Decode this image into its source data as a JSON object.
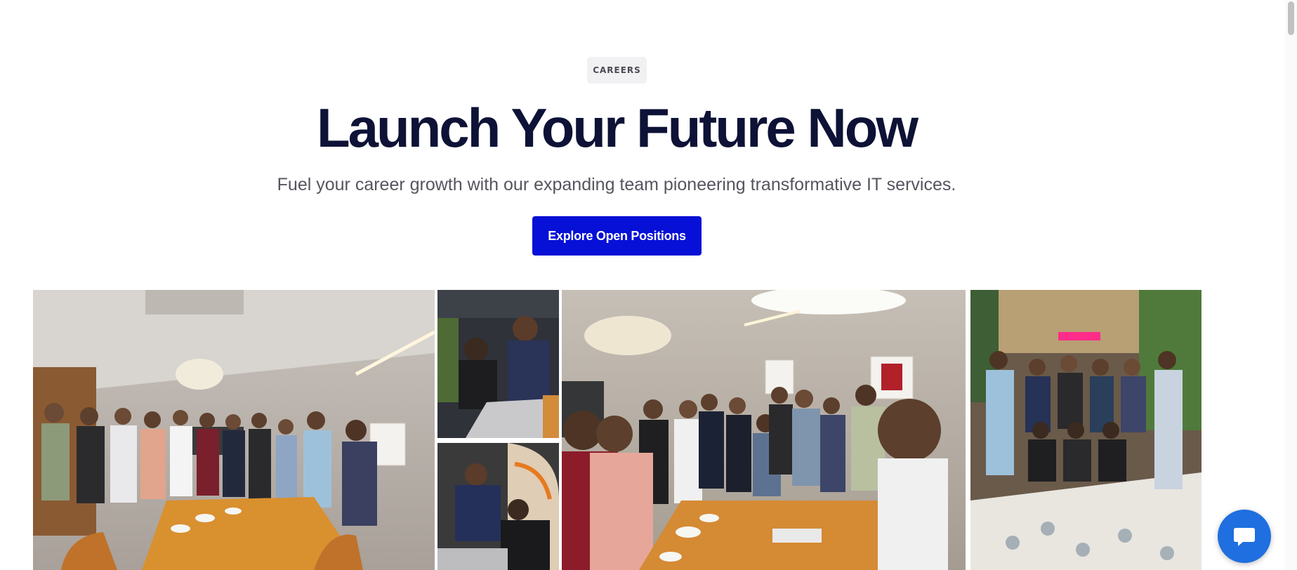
{
  "hero": {
    "eyebrow": "CAREERS",
    "title": "Launch Your Future Now",
    "subtitle": "Fuel your career growth with our expanding team pioneering transformative IT services.",
    "cta_label": "Explore Open Positions"
  },
  "gallery": {
    "photos": [
      {
        "icon": "team-photo-conference-room"
      },
      {
        "icon": "team-photo-laptop-pair"
      },
      {
        "icon": "team-photo-desk-work"
      },
      {
        "icon": "team-photo-group-selfie"
      },
      {
        "icon": "team-photo-restaurant-group"
      }
    ]
  },
  "chat_widget": {
    "icon": "chat-bubble-icon"
  },
  "colors": {
    "accent": "#0710d6",
    "title": "#0d1236",
    "subtitle": "#55555f",
    "chat": "#1f6fe0"
  }
}
